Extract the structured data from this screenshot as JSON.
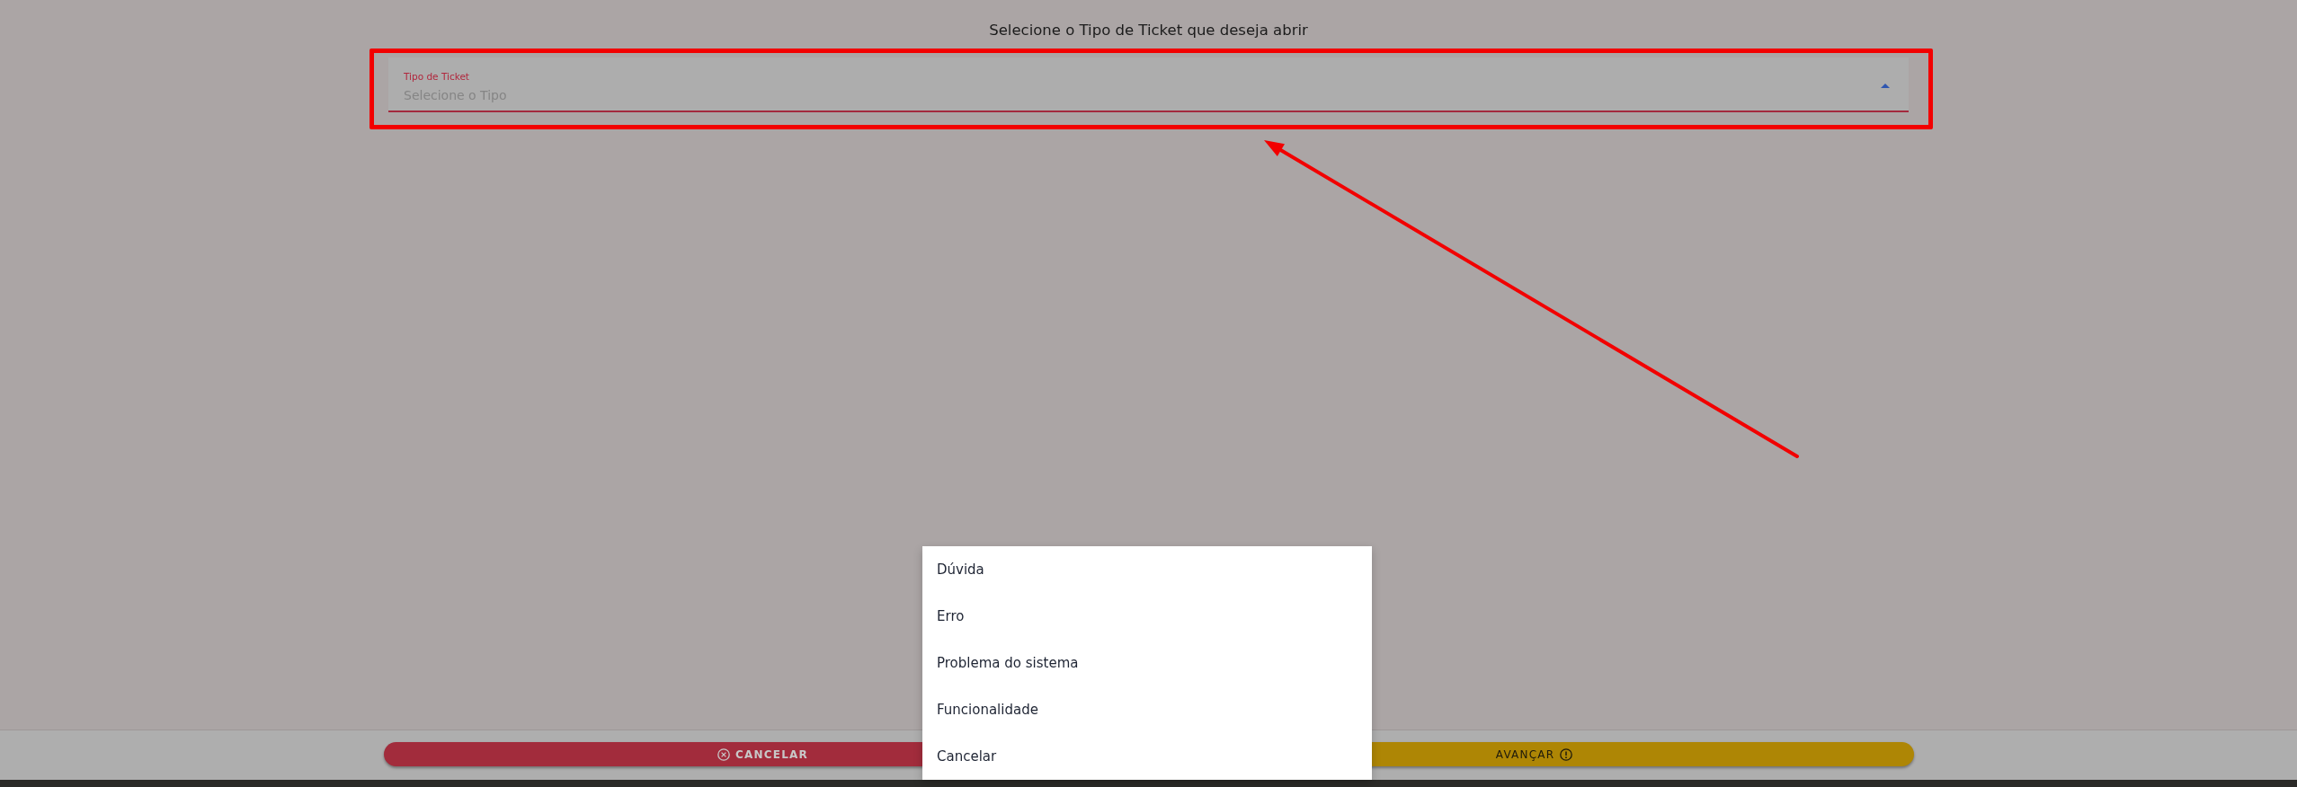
{
  "page": {
    "title": "Selecione o Tipo de Ticket que deseja abrir"
  },
  "ticket_type_field": {
    "label": "Tipo de Ticket",
    "placeholder": "Selecione o Tipo",
    "error": true,
    "expanded": true
  },
  "dropdown": {
    "options": [
      {
        "label": "Dúvida",
        "selected": false
      },
      {
        "label": "Erro",
        "selected": false
      },
      {
        "label": "Problema do sistema",
        "selected": false
      },
      {
        "label": "Funcionalidade",
        "selected": false
      },
      {
        "label": "Cancelar",
        "selected": false
      }
    ]
  },
  "footer": {
    "buttons": [
      {
        "label": "CANCELAR",
        "kind": "cancel"
      },
      {
        "label": "AVANÇAR",
        "kind": "next"
      }
    ]
  }
}
